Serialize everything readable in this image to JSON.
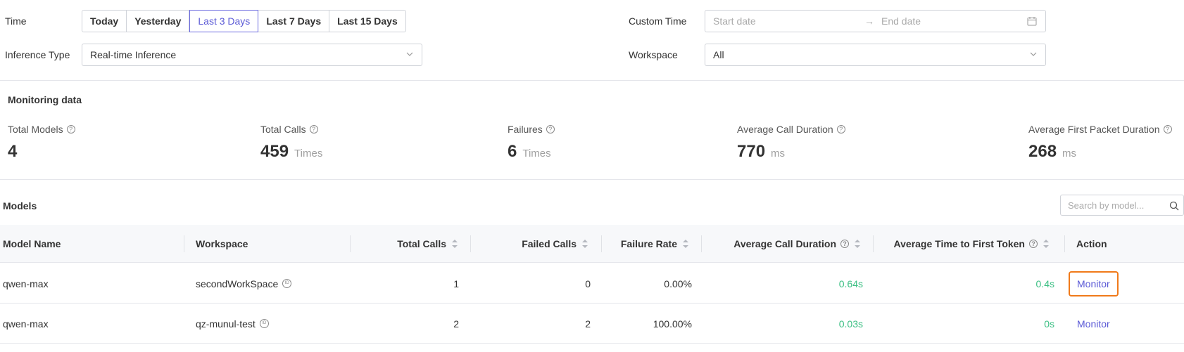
{
  "filters": {
    "time_label": "Time",
    "time_options": [
      "Today",
      "Yesterday",
      "Last 3 Days",
      "Last 7 Days",
      "Last 15 Days"
    ],
    "time_selected": "Last 3 Days",
    "custom_time_label": "Custom Time",
    "start_placeholder": "Start date",
    "range_arrow": "→",
    "end_placeholder": "End date",
    "inference_type_label": "Inference Type",
    "inference_type_value": "Real-time Inference",
    "workspace_label": "Workspace",
    "workspace_value": "All"
  },
  "monitoring": {
    "title": "Monitoring data",
    "stats": [
      {
        "label": "Total Models",
        "value": "4",
        "unit": ""
      },
      {
        "label": "Total Calls",
        "value": "459",
        "unit": "Times"
      },
      {
        "label": "Failures",
        "value": "6",
        "unit": "Times"
      },
      {
        "label": "Average Call Duration",
        "value": "770",
        "unit": "ms"
      },
      {
        "label": "Average First Packet Duration",
        "value": "268",
        "unit": "ms"
      }
    ]
  },
  "models": {
    "title": "Models",
    "search_placeholder": "Search by model...",
    "columns": [
      "Model Name",
      "Workspace",
      "Total Calls",
      "Failed Calls",
      "Failure Rate",
      "Average Call Duration",
      "Average Time to First Token",
      "Action"
    ],
    "rows": [
      {
        "model": "qwen-max",
        "workspace": "secondWorkSpace",
        "total_calls": "1",
        "failed_calls": "0",
        "failure_rate": "0.00%",
        "avg_duration": "0.64s",
        "first_token": "0.4s",
        "action": "Monitor"
      },
      {
        "model": "qwen-max",
        "workspace": "qz-munul-test",
        "total_calls": "2",
        "failed_calls": "2",
        "failure_rate": "100.00%",
        "avg_duration": "0.03s",
        "first_token": "0s",
        "action": "Monitor"
      }
    ]
  },
  "colors": {
    "accent": "#5b5ad6",
    "success": "#3bbf83",
    "highlight": "#f07a1a"
  }
}
